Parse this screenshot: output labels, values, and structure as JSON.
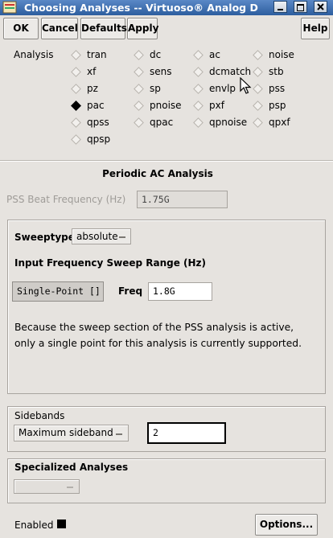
{
  "window": {
    "title": "Choosing Analyses -- Virtuoso® Analog D"
  },
  "buttons": {
    "ok": "OK",
    "cancel": "Cancel",
    "defaults": "Defaults",
    "apply": "Apply",
    "help": "Help"
  },
  "analysis": {
    "label": "Analysis",
    "selected": "pac",
    "options": [
      [
        "tran",
        "dc",
        "ac",
        "noise"
      ],
      [
        "xf",
        "sens",
        "dcmatch",
        "stb"
      ],
      [
        "pz",
        "sp",
        "envlp",
        "pss"
      ],
      [
        "pac",
        "pnoise",
        "pxf",
        "psp"
      ],
      [
        "qpss",
        "qpac",
        "qpnoise",
        "qpxf"
      ],
      [
        "qpsp"
      ]
    ]
  },
  "section": {
    "title": "Periodic AC Analysis"
  },
  "pss_beat": {
    "label": "PSS Beat Frequency (Hz)",
    "value": "1.75G"
  },
  "sweep": {
    "sweeptype_label": "Sweeptype",
    "sweeptype_value": "absolute",
    "range_label": "Input Frequency Sweep Range (Hz)",
    "mode_value": "Single-Point []",
    "freq_label": "Freq",
    "freq_value": "1.8G",
    "note_line1": "Because the sweep section of the PSS analysis is active,",
    "note_line2": "only a single point for this analysis is currently supported."
  },
  "sidebands": {
    "label": "Sidebands",
    "mode_value": "Maximum sideband",
    "value": "2"
  },
  "specialized": {
    "label": "Specialized Analyses",
    "value": ""
  },
  "footer": {
    "enabled_label": "Enabled",
    "options_button": "Options..."
  },
  "colors": {
    "title_bar": "#3d6eb0",
    "background": "#e6e3df"
  }
}
